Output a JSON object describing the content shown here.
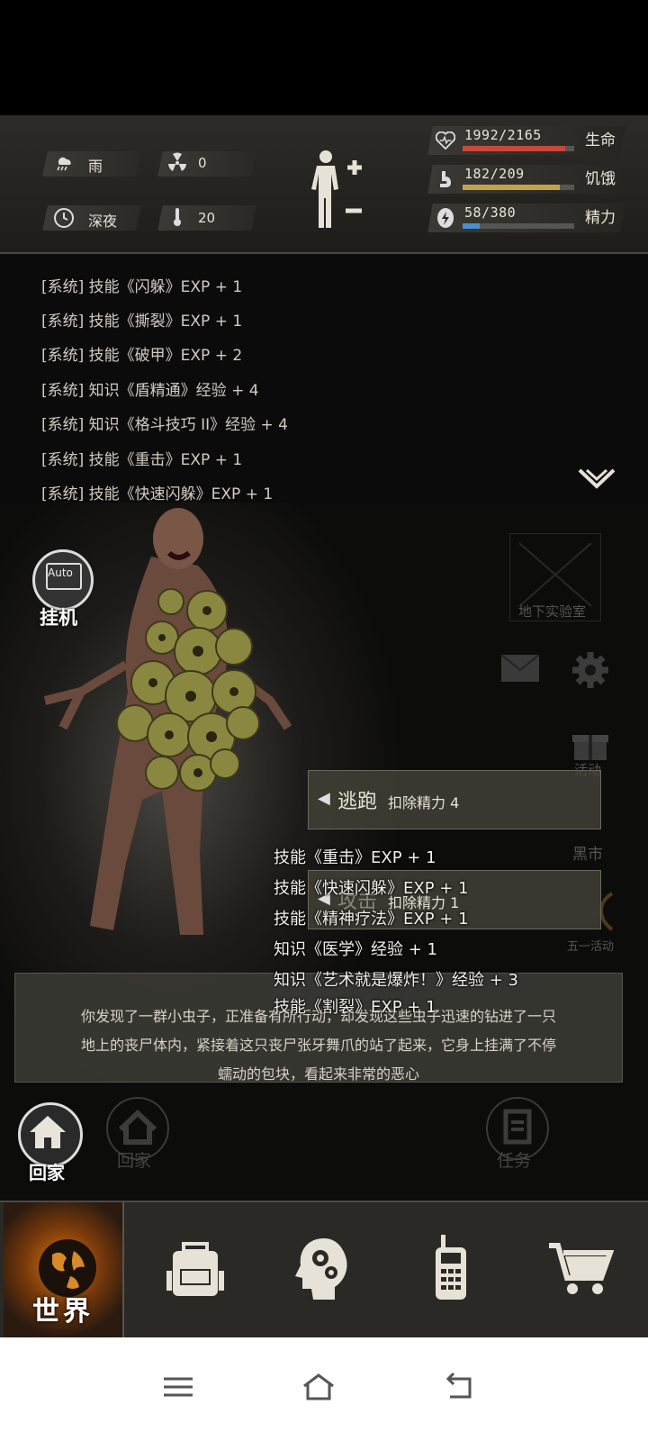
{
  "status": {
    "weather": "雨",
    "radiation": "0",
    "time_of_day": "深夜",
    "temperature": "20",
    "bars": [
      {
        "icon": "heart-pulse-icon",
        "value": "1992/2165",
        "label": "生命",
        "fraction": 0.92,
        "color": "#c9483b"
      },
      {
        "icon": "stomach-icon",
        "value": "182/209",
        "label": "饥饿",
        "fraction": 0.87,
        "color": "#c4a24a"
      },
      {
        "icon": "energy-icon",
        "value": "58/380",
        "label": "精力",
        "fraction": 0.15,
        "color": "#4a8fd0"
      }
    ]
  },
  "log": {
    "lines": [
      "[系统] 技能《闪躲》EXP + 1",
      "[系统] 技能《撕裂》EXP + 1",
      "[系统] 技能《破甲》EXP + 2",
      "[系统] 知识《盾精通》经验 + 4",
      "[系统] 知识《格斗技巧 II》经验 + 4",
      "[系统] 技能《重击》EXP + 1",
      "[系统] 技能《快速闪躲》EXP + 1"
    ]
  },
  "scene": {
    "auto_label": "Auto",
    "auto_caption": "挂机",
    "location_label": "地下实验室",
    "activity_label": "活动",
    "black_market_label": "黑市",
    "event_label": "五一活动",
    "flee": {
      "name": "逃跑",
      "cost": "扣除精力 4"
    },
    "attack": {
      "name": "攻击",
      "cost": "扣除精力 1"
    },
    "floating": [
      "技能《重击》EXP + 1",
      "技能《快速闪躲》EXP + 1",
      "技能《精神疗法》EXP + 1",
      "知识《医学》经验 + 1",
      "知识《艺术就是爆炸！》经验 + 3",
      "技能《割裂》EXP + 1"
    ],
    "story": [
      "你发现了一群小虫子，正准备有所行动，却发现这些虫子迅速的钻进了一只",
      "地上的丧尸体内，紧接着这只丧尸张牙舞爪的站了起来，它身上挂满了不停",
      "蠕动的包块，看起来非常的恶心"
    ],
    "home_label": "回家",
    "home_faint_label": "回家",
    "task_label": "任务"
  },
  "nav": {
    "world_label": "世界",
    "items": [
      "globe-icon",
      "backpack-icon",
      "brain-gears-icon",
      "radio-icon",
      "cart-icon"
    ]
  }
}
